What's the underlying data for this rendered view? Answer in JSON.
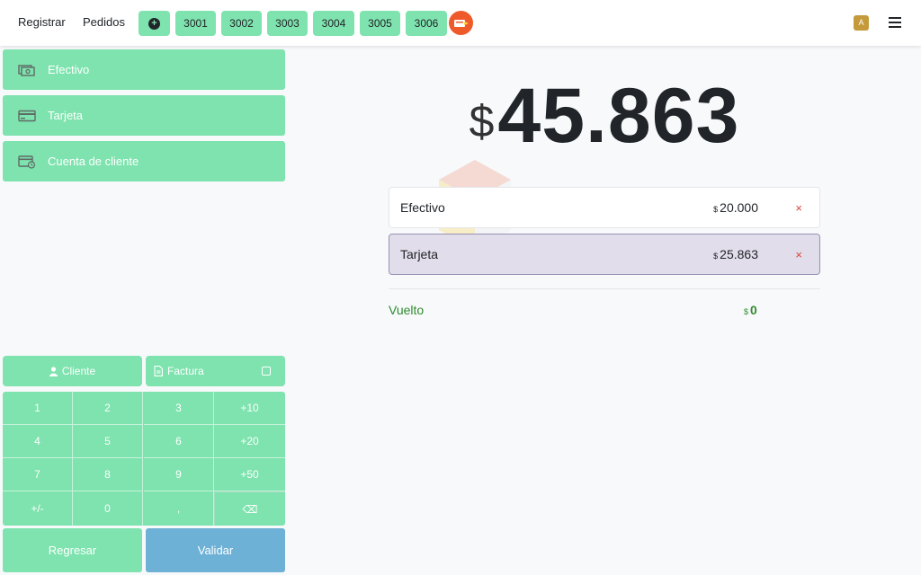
{
  "nav": {
    "registrar": "Registrar",
    "pedidos": "Pedidos",
    "add_icon": "plus-circle-icon",
    "orders": [
      "3001",
      "3002",
      "3003",
      "3004",
      "3005",
      "3006"
    ],
    "avatar_letter": "A"
  },
  "methods": [
    {
      "label": "Efectivo",
      "icon": "cash-icon"
    },
    {
      "label": "Tarjeta",
      "icon": "credit-card-icon"
    },
    {
      "label": "Cuenta de cliente",
      "icon": "customer-account-icon"
    }
  ],
  "cliente_label": "Cliente",
  "factura_label": "Factura",
  "numpad": {
    "keys": [
      "1",
      "2",
      "3",
      "+10",
      "4",
      "5",
      "6",
      "+20",
      "7",
      "8",
      "9",
      "+50",
      "+/-",
      "0",
      ",",
      "⌫"
    ]
  },
  "actions": {
    "back": "Regresar",
    "validate": "Validar"
  },
  "total": {
    "currency": "$",
    "amount": "45.863"
  },
  "payment_lines": [
    {
      "name": "Efectivo",
      "currency": "$",
      "amount": "20.000",
      "remove": "×"
    },
    {
      "name": "Tarjeta",
      "currency": "$",
      "amount": "25.863",
      "remove": "×"
    }
  ],
  "change": {
    "label": "Vuelto",
    "currency": "$",
    "amount": "0"
  },
  "colors": {
    "accent": "#7ee3ae",
    "validate": "#6db1d6",
    "selected_line": "#e2ddea",
    "change": "#2e8b2e",
    "remove": "#d9453b"
  }
}
